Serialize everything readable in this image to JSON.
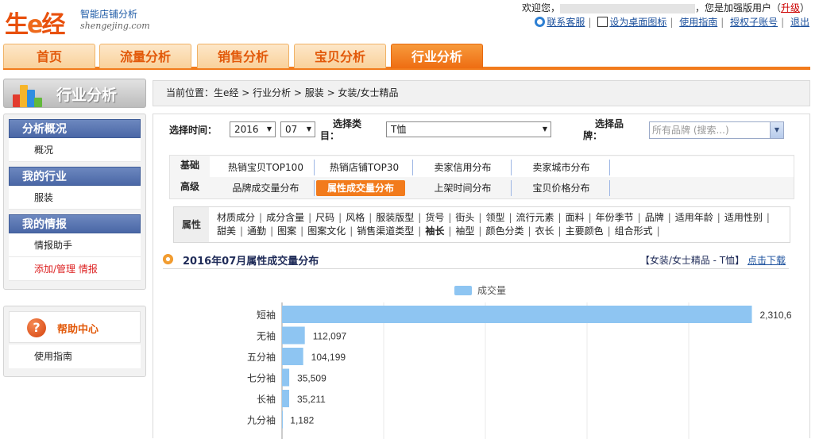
{
  "logo": {
    "big_1": "生",
    "big_2": "e",
    "big_3": "经",
    "tagline": "智能店铺分析",
    "domain": "shengejing.com"
  },
  "topbar": {
    "welcome_prefix": "欢迎您，",
    "welcome_suffix": "，您是加强版用户（",
    "upgrade": "升级",
    "close_paren": "）",
    "links": [
      "联系客服",
      "设为桌面图标",
      "使用指南",
      "授权子账号",
      "退出"
    ]
  },
  "nav": {
    "tabs": [
      "首页",
      "流量分析",
      "销售分析",
      "宝贝分析",
      "行业分析"
    ],
    "active_index": 4
  },
  "sidebar": {
    "title": "行业分析",
    "sections": [
      {
        "header": "分析概况",
        "items": [
          "概况"
        ]
      },
      {
        "header": "我的行业",
        "items": [
          "服装"
        ]
      },
      {
        "header": "我的情报",
        "items": [
          "情报助手",
          "添加/管理 情报"
        ]
      }
    ],
    "help": {
      "title": "帮助中心",
      "items": [
        "使用指南"
      ]
    }
  },
  "breadcrumb": "当前位置：生e经 > 行业分析 > 服装 > 女装/女士精品",
  "filters": {
    "time_label": "选择时间：",
    "year": "2016",
    "month": "07",
    "category_label_1": "选择类",
    "category_label_2": "目：",
    "category_value": "T恤",
    "brand_label_1": "选择品",
    "brand_label_2": "牌：",
    "brand_placeholder": "所有品牌 (搜索...)"
  },
  "analysis_tabs": {
    "basic_label": "基础",
    "basic": [
      "热销宝贝TOP100",
      "热销店铺TOP30",
      "卖家信用分布",
      "卖家城市分布"
    ],
    "advanced_label": "高级",
    "advanced": [
      "品牌成交量分布",
      "属性成交量分布",
      "上架时间分布",
      "宝贝价格分布"
    ],
    "active_advanced_index": 1
  },
  "attributes": {
    "label": "属性",
    "items": [
      "材质成分",
      "成分含量",
      "尺码",
      "风格",
      "服装版型",
      "货号",
      "街头",
      "领型",
      "流行元素",
      "面料",
      "年份季节",
      "品牌",
      "适用年龄",
      "适用性别",
      "甜美",
      "通勤",
      "图案",
      "图案文化",
      "销售渠道类型",
      "袖长",
      "袖型",
      "颜色分类",
      "衣长",
      "主要颜色",
      "组合形式"
    ],
    "selected": "袖长"
  },
  "chart_header": {
    "title": "2016年07月属性成交量分布",
    "context": "【女装/女士精品 - T恤】",
    "download": "点击下载"
  },
  "chart_data": {
    "type": "bar",
    "orientation": "horizontal",
    "legend": [
      "成交量"
    ],
    "categories": [
      "短袖",
      "无袖",
      "五分袖",
      "七分袖",
      "长袖",
      "九分袖"
    ],
    "series": [
      {
        "name": "成交量",
        "values": [
          2310600,
          112097,
          104199,
          35509,
          35211,
          1182
        ]
      }
    ],
    "value_labels": [
      "2,310,6",
      "112,097",
      "104,199",
      "35,509",
      "35,211",
      "1,182"
    ],
    "xlim": [
      0,
      2500000
    ],
    "grid": true,
    "color": "#8ec5f2"
  },
  "colors": {
    "accent": "#f27b1c",
    "nav_active": "#ee6d12",
    "sidebar_header": "#4a67a6",
    "bar": "#8ec5f2",
    "link": "#1a4f9c"
  }
}
